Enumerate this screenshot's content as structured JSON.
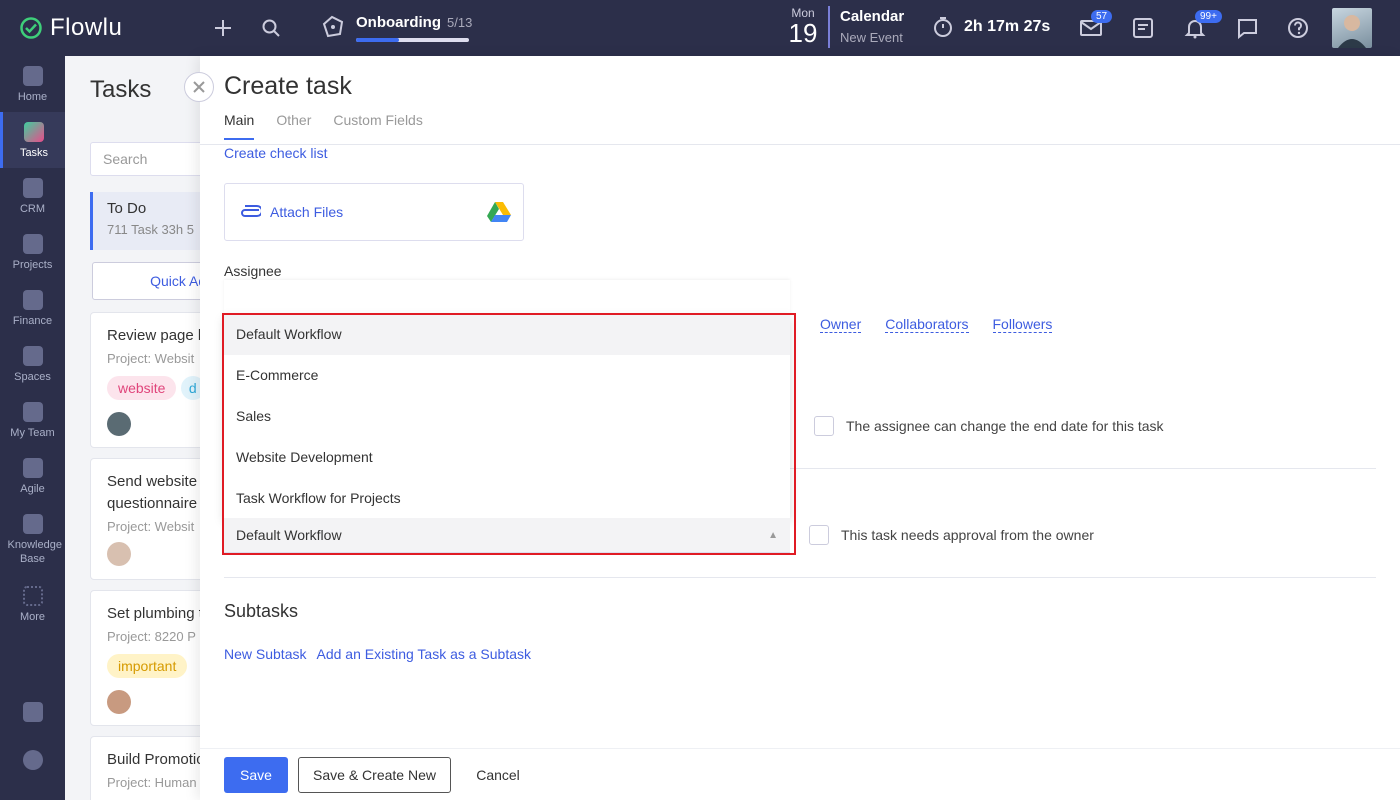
{
  "app": {
    "name": "Flowlu"
  },
  "topbar": {
    "onboarding": {
      "label": "Onboarding",
      "count": "5/13",
      "progress": 0.38
    },
    "date": {
      "weekday": "Mon",
      "day": "19"
    },
    "calendar": {
      "title": "Calendar",
      "subtitle": "New Event"
    },
    "timer": "2h 17m 27s",
    "mail_badge": "57",
    "notif_badge": "99+"
  },
  "sidebar": {
    "items": [
      {
        "label": "Home"
      },
      {
        "label": "Tasks"
      },
      {
        "label": "CRM"
      },
      {
        "label": "Projects"
      },
      {
        "label": "Finance"
      },
      {
        "label": "Spaces"
      },
      {
        "label": "My Team"
      },
      {
        "label": "Agile"
      },
      {
        "label": "Knowledge Base"
      },
      {
        "label": "More"
      }
    ]
  },
  "tasks_panel": {
    "title": "Tasks",
    "search_placeholder": "Search",
    "column": {
      "title": "To Do",
      "stats": "711 Task   33h 5"
    },
    "quick_add": "Quick Add",
    "cards": [
      {
        "title": "Review page l",
        "project": "Project: Websit",
        "tags": [
          "website",
          "d"
        ]
      },
      {
        "title": "Send website",
        "title2": "questionnaire",
        "project": "Project: Websit"
      },
      {
        "title": "Set plumbing t",
        "project": "Project: 8220 P",
        "tags": [
          "important"
        ]
      },
      {
        "title": "Build Promotic",
        "project": "Project: Human"
      }
    ]
  },
  "create_task": {
    "title": "Create task",
    "tabs": [
      "Main",
      "Other",
      "Custom Fields"
    ],
    "create_checklist": "Create check list",
    "attach_files": "Attach Files",
    "assignee_label": "Assignee",
    "roles": [
      "Owner",
      "Collaborators",
      "Followers"
    ],
    "change_end_date_label": "The assignee can change the end date for this task",
    "approval_label": "This task needs approval from the owner",
    "workflow": {
      "selected": "Default Workflow",
      "options": [
        "Default Workflow",
        "E-Commerce",
        "Sales",
        "Website Development",
        "Task Workflow for Projects"
      ]
    },
    "subtasks": {
      "title": "Subtasks",
      "new_subtask": "New Subtask",
      "add_existing": "Add an Existing Task as a Subtask"
    },
    "footer": {
      "save": "Save",
      "save_new": "Save & Create New",
      "cancel": "Cancel"
    }
  }
}
